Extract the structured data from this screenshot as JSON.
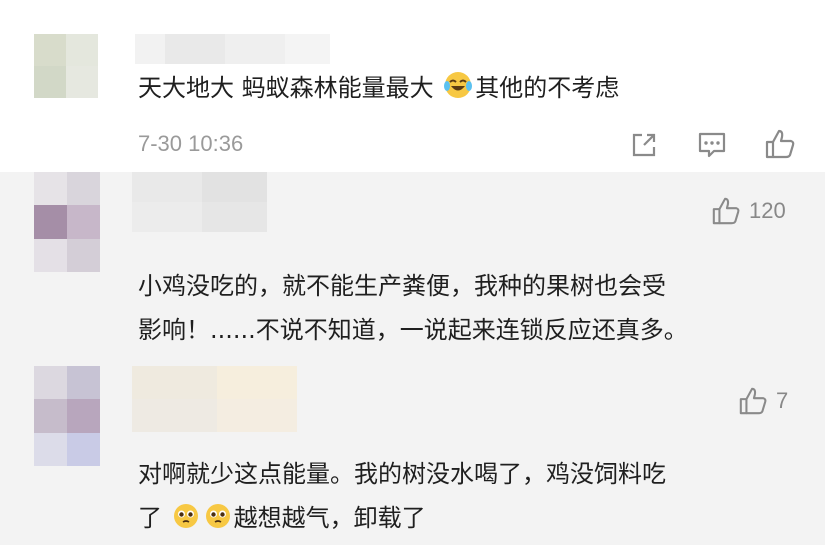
{
  "comments": [
    {
      "text_line1": "天大地大 蚂蚁森林能量最大",
      "emoji_1": "laughing-tears-emoji",
      "text_line1_tail": "其他的不考虑",
      "time": "7-30 10:36",
      "actions": [
        "share-icon",
        "comment-icon",
        "like-icon"
      ]
    },
    {
      "like_count": "120",
      "text_line1": "小鸡没吃的，就不能生产粪便，我种的果树也会受",
      "text_line2": "影响！......不说不知道，一说起来连锁反应还真多。"
    },
    {
      "like_count": "7",
      "text_line1": "对啊就少这点能量。我的树没水喝了，鸡没饲料吃",
      "text_line2_prefix": "了",
      "emoji_2": "pleading-face-emoji",
      "text_line2_tail": "越想越气，卸载了"
    }
  ],
  "colors": {
    "background": "#ffffff",
    "reply_background": "#f3f3f3",
    "meta_gray": "#9a9a9a",
    "text": "#1f1f1f",
    "emoji_yellow": "#f7c843"
  }
}
